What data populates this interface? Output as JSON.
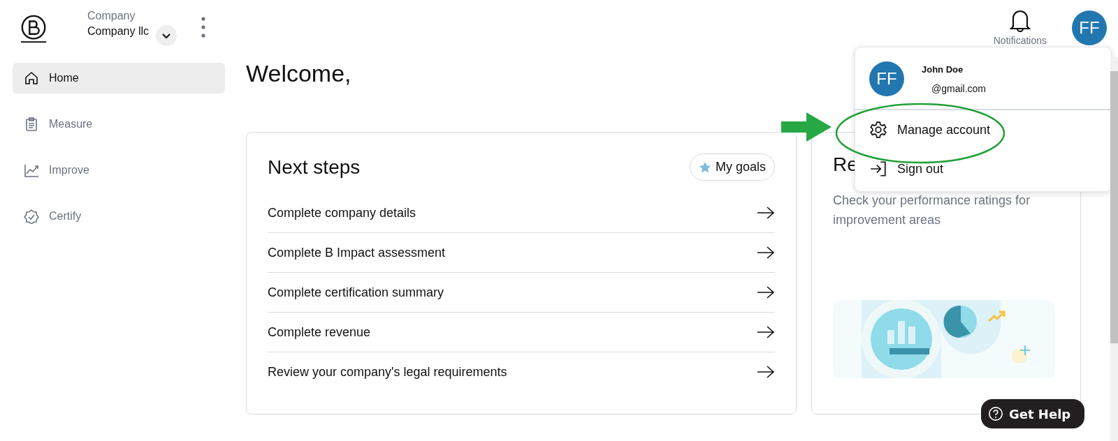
{
  "company": {
    "label": "Company",
    "name": "Company llc"
  },
  "sidebar": {
    "items": [
      {
        "label": "Home",
        "kind": "home",
        "selected": true
      },
      {
        "label": "Measure",
        "kind": "clipboard",
        "selected": false
      },
      {
        "label": "Improve",
        "kind": "chart",
        "selected": false
      },
      {
        "label": "Certify",
        "kind": "badge",
        "selected": false
      }
    ]
  },
  "header": {
    "notifications": "Notifications",
    "avatar": "FF"
  },
  "welcome": "Welcome,",
  "next_steps": {
    "title": "Next steps",
    "goals_button": "My goals",
    "items": [
      "Complete company details",
      "Complete B Impact assessment",
      "Complete certification summary",
      "Complete revenue",
      "Review your company's legal requirements"
    ]
  },
  "report_card": {
    "title": "Re",
    "text": "Check your performance ratings for improvement areas"
  },
  "account_menu": {
    "avatar": "FF",
    "name": "John Doe",
    "email": "@gmail.com",
    "items": [
      {
        "label": "Manage account",
        "kind": "settings",
        "highlighted": true
      },
      {
        "label": "Sign out",
        "kind": "signout",
        "highlighted": false
      }
    ]
  },
  "help_button": "Get Help"
}
